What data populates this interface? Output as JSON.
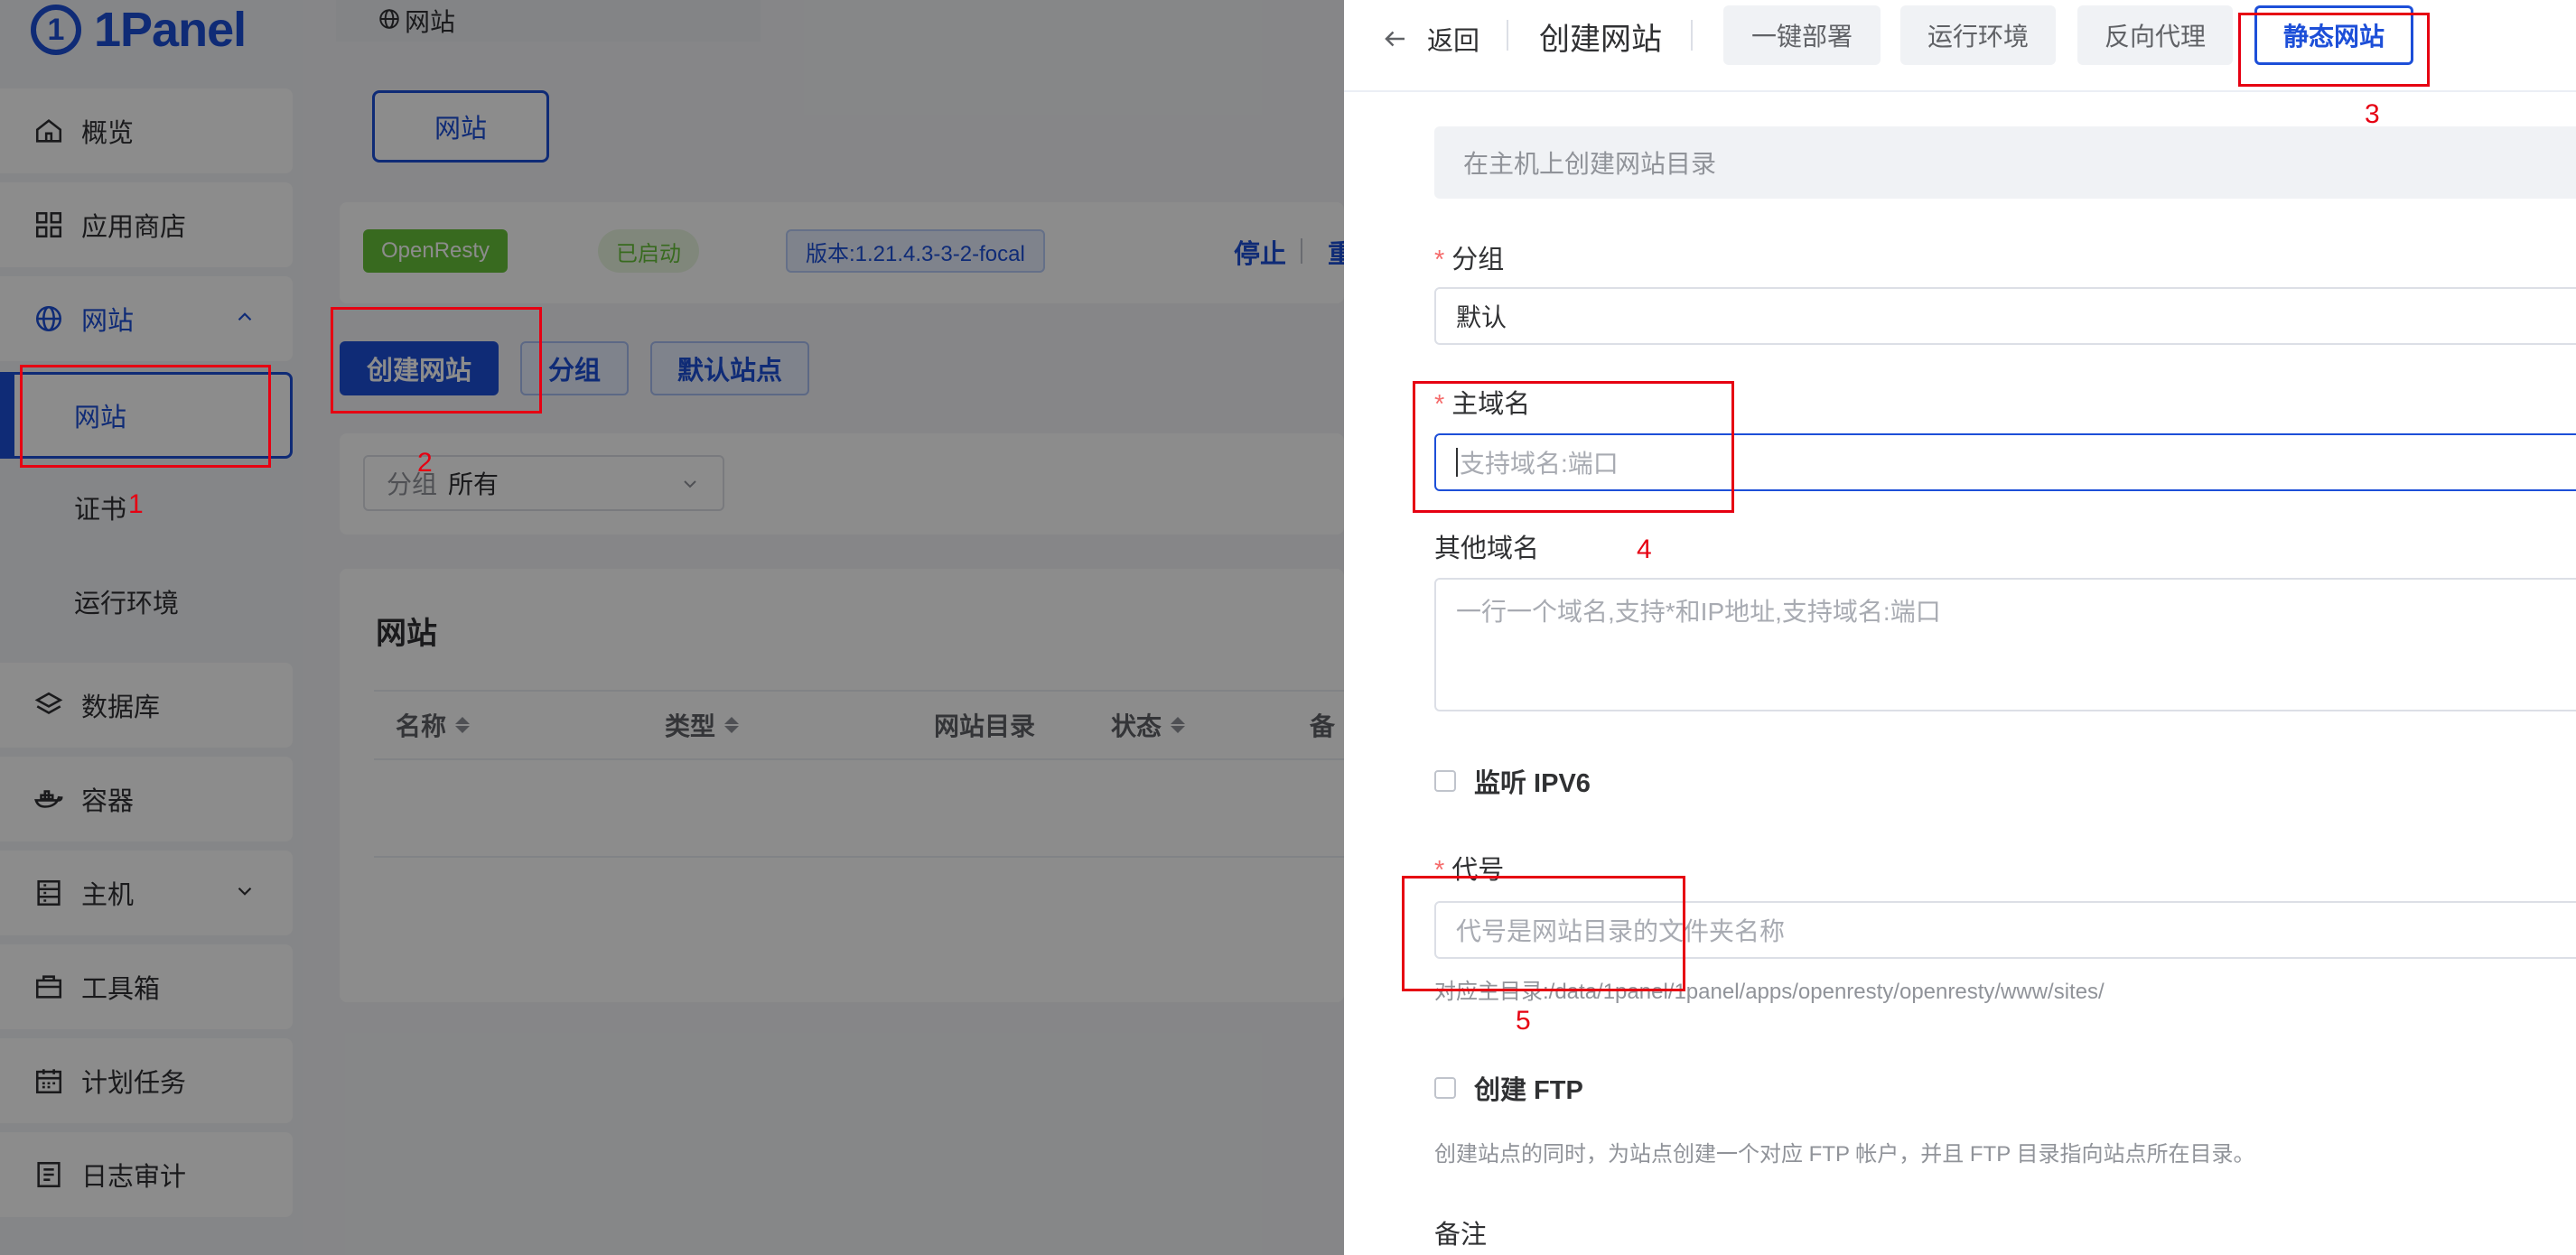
{
  "app": {
    "logo_text": "1Panel",
    "logo_badge": "1"
  },
  "sidebar": {
    "items": [
      {
        "label": "概览",
        "icon": "home-icon"
      },
      {
        "label": "应用商店",
        "icon": "apps-icon"
      },
      {
        "label": "网站",
        "icon": "globe-icon"
      },
      {
        "label": "数据库",
        "icon": "layers-icon"
      },
      {
        "label": "容器",
        "icon": "docker-icon"
      },
      {
        "label": "主机",
        "icon": "host-icon"
      },
      {
        "label": "工具箱",
        "icon": "toolbox-icon"
      },
      {
        "label": "计划任务",
        "icon": "calendar-icon"
      },
      {
        "label": "日志审计",
        "icon": "log-icon"
      }
    ],
    "website_sub": [
      "网站",
      "证书",
      "运行环境"
    ]
  },
  "breadcrumb": {
    "label": "网站"
  },
  "page_tab": {
    "label": "网站"
  },
  "app_status": {
    "app_name": "OpenResty",
    "status": "已启动",
    "version": "版本:1.21.4.3-3-2-focal",
    "stop": "停止",
    "restart_partial": "重"
  },
  "toolbar": {
    "create": "创建网站",
    "group": "分组",
    "default_site": "默认站点"
  },
  "filter": {
    "label": "分组",
    "value": "所有"
  },
  "table": {
    "title": "网站",
    "columns": [
      "名称",
      "类型",
      "网站目录",
      "状态",
      "备"
    ]
  },
  "annotations": [
    "1",
    "2",
    "3",
    "4",
    "5"
  ],
  "drawer": {
    "back": "返回",
    "title": "创建网站",
    "tabs": [
      "一键部署",
      "运行环境",
      "反向代理",
      "静态网站"
    ],
    "active_tab": "静态网站",
    "note": "在主机上创建网站目录",
    "group": {
      "label": "分组",
      "value": "默认"
    },
    "primary_domain": {
      "label": "主域名",
      "placeholder": "支持域名:端口"
    },
    "other_domains": {
      "label": "其他域名",
      "placeholder": "一行一个域名,支持*和IP地址,支持域名:端口"
    },
    "ipv6": {
      "label": "监听 IPV6"
    },
    "alias": {
      "label": "代号",
      "placeholder": "代号是网站目录的文件夹名称",
      "hint": "对应主目录:/data/1panel/1panel/apps/openresty/openresty/www/sites/"
    },
    "ftp": {
      "label": "创建 FTP",
      "hint": "创建站点的同时，为站点创建一个对应 FTP 帐户，并且 FTP 目录指向站点所在目录。"
    },
    "remark": {
      "label": "备注"
    }
  },
  "colors": {
    "primary": "#1d4fd8",
    "annotation": "#e60012",
    "success": "#67c23a",
    "required": "#f56c6c"
  }
}
